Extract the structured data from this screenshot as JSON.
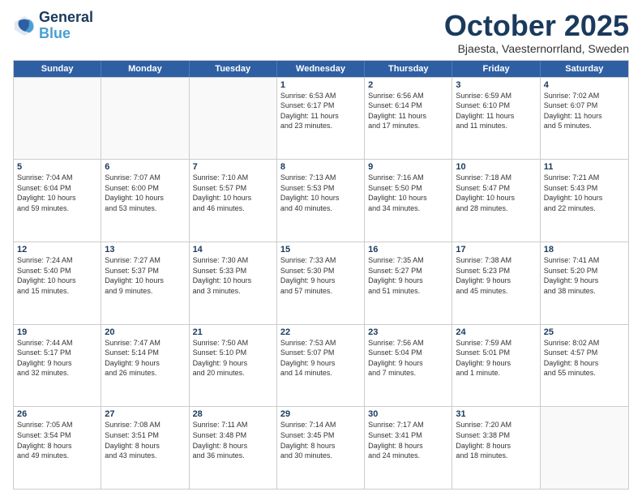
{
  "header": {
    "logo_general": "General",
    "logo_blue": "Blue",
    "month": "October 2025",
    "location": "Bjaesta, Vaesternorrland, Sweden"
  },
  "weekdays": [
    "Sunday",
    "Monday",
    "Tuesday",
    "Wednesday",
    "Thursday",
    "Friday",
    "Saturday"
  ],
  "rows": [
    [
      {
        "day": "",
        "text": ""
      },
      {
        "day": "",
        "text": ""
      },
      {
        "day": "",
        "text": ""
      },
      {
        "day": "1",
        "text": "Sunrise: 6:53 AM\nSunset: 6:17 PM\nDaylight: 11 hours\nand 23 minutes."
      },
      {
        "day": "2",
        "text": "Sunrise: 6:56 AM\nSunset: 6:14 PM\nDaylight: 11 hours\nand 17 minutes."
      },
      {
        "day": "3",
        "text": "Sunrise: 6:59 AM\nSunset: 6:10 PM\nDaylight: 11 hours\nand 11 minutes."
      },
      {
        "day": "4",
        "text": "Sunrise: 7:02 AM\nSunset: 6:07 PM\nDaylight: 11 hours\nand 5 minutes."
      }
    ],
    [
      {
        "day": "5",
        "text": "Sunrise: 7:04 AM\nSunset: 6:04 PM\nDaylight: 10 hours\nand 59 minutes."
      },
      {
        "day": "6",
        "text": "Sunrise: 7:07 AM\nSunset: 6:00 PM\nDaylight: 10 hours\nand 53 minutes."
      },
      {
        "day": "7",
        "text": "Sunrise: 7:10 AM\nSunset: 5:57 PM\nDaylight: 10 hours\nand 46 minutes."
      },
      {
        "day": "8",
        "text": "Sunrise: 7:13 AM\nSunset: 5:53 PM\nDaylight: 10 hours\nand 40 minutes."
      },
      {
        "day": "9",
        "text": "Sunrise: 7:16 AM\nSunset: 5:50 PM\nDaylight: 10 hours\nand 34 minutes."
      },
      {
        "day": "10",
        "text": "Sunrise: 7:18 AM\nSunset: 5:47 PM\nDaylight: 10 hours\nand 28 minutes."
      },
      {
        "day": "11",
        "text": "Sunrise: 7:21 AM\nSunset: 5:43 PM\nDaylight: 10 hours\nand 22 minutes."
      }
    ],
    [
      {
        "day": "12",
        "text": "Sunrise: 7:24 AM\nSunset: 5:40 PM\nDaylight: 10 hours\nand 15 minutes."
      },
      {
        "day": "13",
        "text": "Sunrise: 7:27 AM\nSunset: 5:37 PM\nDaylight: 10 hours\nand 9 minutes."
      },
      {
        "day": "14",
        "text": "Sunrise: 7:30 AM\nSunset: 5:33 PM\nDaylight: 10 hours\nand 3 minutes."
      },
      {
        "day": "15",
        "text": "Sunrise: 7:33 AM\nSunset: 5:30 PM\nDaylight: 9 hours\nand 57 minutes."
      },
      {
        "day": "16",
        "text": "Sunrise: 7:35 AM\nSunset: 5:27 PM\nDaylight: 9 hours\nand 51 minutes."
      },
      {
        "day": "17",
        "text": "Sunrise: 7:38 AM\nSunset: 5:23 PM\nDaylight: 9 hours\nand 45 minutes."
      },
      {
        "day": "18",
        "text": "Sunrise: 7:41 AM\nSunset: 5:20 PM\nDaylight: 9 hours\nand 38 minutes."
      }
    ],
    [
      {
        "day": "19",
        "text": "Sunrise: 7:44 AM\nSunset: 5:17 PM\nDaylight: 9 hours\nand 32 minutes."
      },
      {
        "day": "20",
        "text": "Sunrise: 7:47 AM\nSunset: 5:14 PM\nDaylight: 9 hours\nand 26 minutes."
      },
      {
        "day": "21",
        "text": "Sunrise: 7:50 AM\nSunset: 5:10 PM\nDaylight: 9 hours\nand 20 minutes."
      },
      {
        "day": "22",
        "text": "Sunrise: 7:53 AM\nSunset: 5:07 PM\nDaylight: 9 hours\nand 14 minutes."
      },
      {
        "day": "23",
        "text": "Sunrise: 7:56 AM\nSunset: 5:04 PM\nDaylight: 9 hours\nand 7 minutes."
      },
      {
        "day": "24",
        "text": "Sunrise: 7:59 AM\nSunset: 5:01 PM\nDaylight: 9 hours\nand 1 minute."
      },
      {
        "day": "25",
        "text": "Sunrise: 8:02 AM\nSunset: 4:57 PM\nDaylight: 8 hours\nand 55 minutes."
      }
    ],
    [
      {
        "day": "26",
        "text": "Sunrise: 7:05 AM\nSunset: 3:54 PM\nDaylight: 8 hours\nand 49 minutes."
      },
      {
        "day": "27",
        "text": "Sunrise: 7:08 AM\nSunset: 3:51 PM\nDaylight: 8 hours\nand 43 minutes."
      },
      {
        "day": "28",
        "text": "Sunrise: 7:11 AM\nSunset: 3:48 PM\nDaylight: 8 hours\nand 36 minutes."
      },
      {
        "day": "29",
        "text": "Sunrise: 7:14 AM\nSunset: 3:45 PM\nDaylight: 8 hours\nand 30 minutes."
      },
      {
        "day": "30",
        "text": "Sunrise: 7:17 AM\nSunset: 3:41 PM\nDaylight: 8 hours\nand 24 minutes."
      },
      {
        "day": "31",
        "text": "Sunrise: 7:20 AM\nSunset: 3:38 PM\nDaylight: 8 hours\nand 18 minutes."
      },
      {
        "day": "",
        "text": ""
      }
    ]
  ]
}
